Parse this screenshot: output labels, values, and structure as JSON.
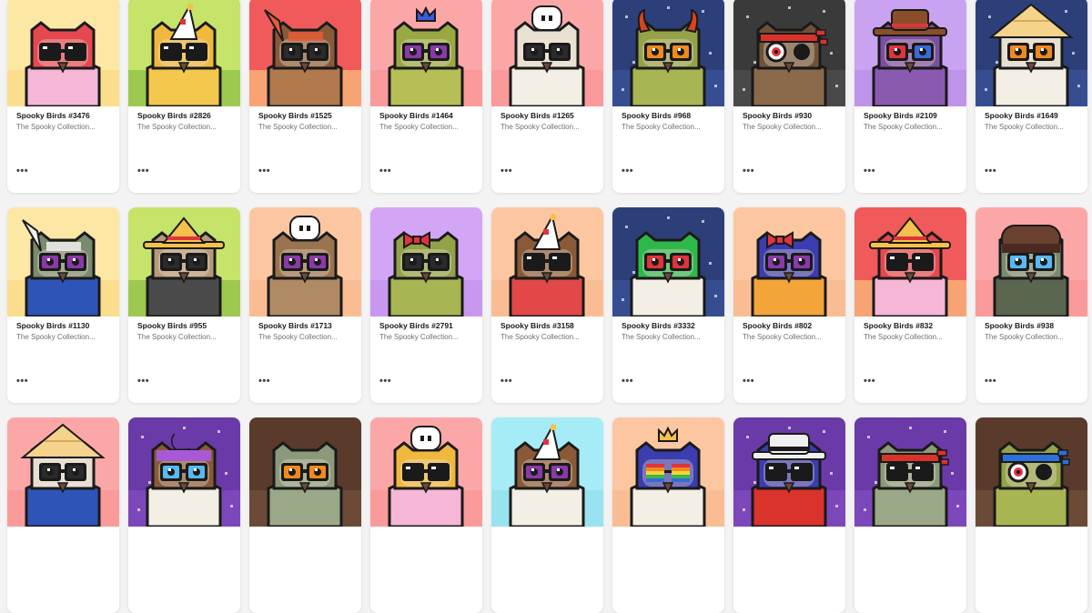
{
  "collection": "The Spooky Collection...",
  "more_label": "•••",
  "items": [
    {
      "name": "Spooky Birds #3476",
      "bg": "#fde7a4",
      "bg2": "#f9d77a",
      "body": "#f6b6d6",
      "head": "#e64850",
      "hat": "none",
      "hatColor": "#e64850",
      "glasses": "shades",
      "icon": "owl-mask-icon"
    },
    {
      "name": "Spooky Birds #2826",
      "bg": "#c6e36a",
      "bg2": "#7bb43a",
      "body": "#f4c84c",
      "head": "#f0b83c",
      "hat": "party",
      "hatColor": "#ffffff",
      "glasses": "shades",
      "icon": "owl-party-hat-icon"
    },
    {
      "name": "Spooky Birds #1525",
      "bg": "#f05a5a",
      "bg2": "#ffe08a",
      "body": "#b07a4e",
      "head": "#8a5a38",
      "hat": "feather",
      "hatColor": "#e85c38",
      "glasses": "round",
      "icon": "owl-feather-icon"
    },
    {
      "name": "Spooky Birds #1464",
      "bg": "#fca7a7",
      "bg2": "#f78f8f",
      "body": "#b5bf55",
      "head": "#9aa844",
      "hat": "crown",
      "hatColor": "#3b5bd9",
      "glasses": "purple",
      "icon": "owl-crown-icon"
    },
    {
      "name": "Spooky Birds #1265",
      "bg": "#fca7a7",
      "bg2": "#f78f8f",
      "body": "#f4efe4",
      "head": "#e8e1d2",
      "hat": "chef",
      "hatColor": "#ffffff",
      "glasses": "round",
      "icon": "owl-chef-icon"
    },
    {
      "name": "Spooky Birds #968",
      "bg": "#2c3f78",
      "bg2": "#3f5aa6",
      "body": "#a8b552",
      "head": "#94a248",
      "hat": "horns",
      "hatColor": "#d9441e",
      "glasses": "orange",
      "icon": "owl-horns-icon"
    },
    {
      "name": "Spooky Birds #930",
      "bg": "#3a3a3a",
      "bg2": "#555555",
      "body": "#8a6a4a",
      "head": "#6f5238",
      "hat": "bandana",
      "hatColor": "#d9332b",
      "glasses": "monocle",
      "icon": "owl-bandana-icon"
    },
    {
      "name": "Spooky Birds #2109",
      "bg": "#c9a3f2",
      "bg2": "#b489e6",
      "body": "#8a5ab0",
      "head": "#7a4ea0",
      "hat": "cowboy",
      "hatColor": "#8a4e2a",
      "glasses": "3d",
      "icon": "owl-cowboy-icon"
    },
    {
      "name": "Spooky Birds #1649",
      "bg": "#2c3f78",
      "bg2": "#3f5aa6",
      "body": "#f4efe4",
      "head": "#e6dfcf",
      "hat": "conical",
      "hatColor": "#f5d38a",
      "glasses": "orange",
      "icon": "owl-conical-hat-icon"
    },
    {
      "name": "Spooky Birds #1130",
      "bg": "#fde7a4",
      "bg2": "#f9d77a",
      "body": "#2f54b8",
      "head": "#7a8a6e",
      "hat": "feather",
      "hatColor": "#f0f0f0",
      "glasses": "purple",
      "icon": "owl-feather-icon"
    },
    {
      "name": "Spooky Birds #955",
      "bg": "#c6e36a",
      "bg2": "#7bb43a",
      "body": "#4a4a4a",
      "head": "#b79a7a",
      "hat": "sombrero",
      "hatColor": "#f5c14a",
      "glasses": "round",
      "icon": "owl-sombrero-icon"
    },
    {
      "name": "Spooky Birds #1713",
      "bg": "#fcc7a0",
      "bg2": "#f7b488",
      "body": "#b08a64",
      "head": "#9a744e",
      "hat": "chef",
      "hatColor": "#ffffff",
      "glasses": "purple",
      "icon": "owl-chef-icon"
    },
    {
      "name": "Spooky Birds #2791",
      "bg": "#d3a6f5",
      "bg2": "#c08ceb",
      "body": "#a8b552",
      "head": "#94a248",
      "hat": "bow",
      "hatColor": "#e0343c",
      "glasses": "round",
      "icon": "owl-bow-icon"
    },
    {
      "name": "Spooky Birds #3158",
      "bg": "#fcc7a0",
      "bg2": "#f7b488",
      "body": "#e24848",
      "head": "#8a5a38",
      "hat": "party",
      "hatColor": "#ffffff",
      "glasses": "shades",
      "icon": "owl-party-hat-icon"
    },
    {
      "name": "Spooky Birds #3332",
      "bg": "#2c3f78",
      "bg2": "#3f5aa6",
      "body": "#f4efe4",
      "head": "#2fb84a",
      "hat": "none",
      "hatColor": "#2fb84a",
      "glasses": "red",
      "icon": "owl-mask-icon"
    },
    {
      "name": "Spooky Birds #802",
      "bg": "#fcc7a0",
      "bg2": "#f7b488",
      "body": "#f4a53a",
      "head": "#3b3db0",
      "hat": "bow",
      "hatColor": "#e0343c",
      "glasses": "purple",
      "icon": "owl-bow-icon"
    },
    {
      "name": "Spooky Birds #832",
      "bg": "#f05a5a",
      "bg2": "#ffe08a",
      "body": "#f6b6d6",
      "head": "#e64850",
      "hat": "sombrero",
      "hatColor": "#f5c14a",
      "glasses": "shades",
      "icon": "owl-sombrero-icon"
    },
    {
      "name": "Spooky Birds #938",
      "bg": "#fca7a7",
      "bg2": "#f78f8f",
      "body": "#5a6650",
      "head": "#7a8a6e",
      "hat": "beanie",
      "hatColor": "#6a4030",
      "glasses": "blue",
      "icon": "owl-beanie-icon"
    },
    {
      "name": "",
      "bg": "#fca7a7",
      "bg2": "#f78f8f",
      "body": "#2f54b8",
      "head": "#e6dfcf",
      "hat": "conical",
      "hatColor": "#f5d38a",
      "glasses": "round",
      "icon": "owl-conical-hat-icon"
    },
    {
      "name": "",
      "bg": "#6a3aa8",
      "bg2": "#8a52c8",
      "body": "#f4efe4",
      "head": "#8a5a38",
      "hat": "moon",
      "hatColor": "#a85ad6",
      "glasses": "blue",
      "icon": "owl-moon-icon"
    },
    {
      "name": "",
      "bg": "#5a3a2a",
      "bg2": "#7a5a44",
      "body": "#9aa888",
      "head": "#8a9a7a",
      "hat": "none",
      "hatColor": "#d8c8b0",
      "glasses": "orange",
      "icon": "owl-bandage-icon"
    },
    {
      "name": "",
      "bg": "#fca7a7",
      "bg2": "#f78f8f",
      "body": "#f6b6d6",
      "head": "#f0b83c",
      "hat": "chef",
      "hatColor": "#ffffff",
      "glasses": "shades",
      "icon": "owl-chef-icon"
    },
    {
      "name": "",
      "bg": "#a6ecf7",
      "bg2": "#8adcea",
      "body": "#f4efe4",
      "head": "#8a5a38",
      "hat": "party",
      "hatColor": "#ffffff",
      "glasses": "purple",
      "icon": "owl-party-hat-icon"
    },
    {
      "name": "",
      "bg": "#fcc7a0",
      "bg2": "#f7b488",
      "body": "#f4efe4",
      "head": "#3b3db0",
      "hat": "crown",
      "hatColor": "#f5c14a",
      "glasses": "rainbow",
      "icon": "owl-crown-icon"
    },
    {
      "name": "",
      "bg": "#6a3aa8",
      "bg2": "#8a52c8",
      "body": "#d9332b",
      "head": "#3b3db0",
      "hat": "fedora",
      "hatColor": "#f0f0f0",
      "glasses": "shades",
      "icon": "owl-fedora-icon"
    },
    {
      "name": "",
      "bg": "#6a3aa8",
      "bg2": "#8a52c8",
      "body": "#9aa888",
      "head": "#8a9a7a",
      "hat": "bandana",
      "hatColor": "#d9332b",
      "glasses": "shades",
      "icon": "owl-bandana-icon"
    },
    {
      "name": "",
      "bg": "#5a3a2a",
      "bg2": "#7a5a44",
      "body": "#a8b552",
      "head": "#94a248",
      "hat": "bandana",
      "hatColor": "#2f6fd9",
      "glasses": "monocle",
      "icon": "owl-bandana-icon"
    }
  ]
}
